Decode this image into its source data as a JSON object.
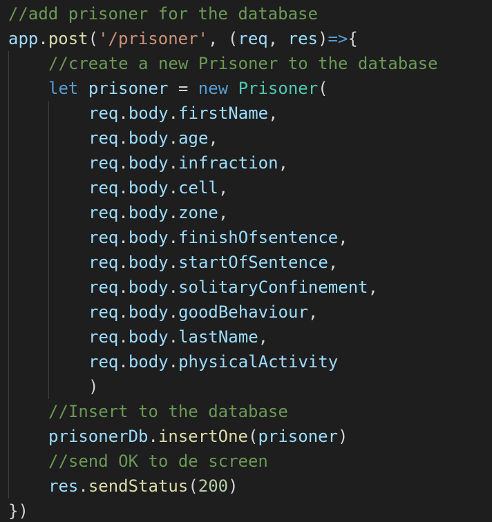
{
  "editor": {
    "theme": {
      "background": "#1e1e1e",
      "comment": "#6a9955",
      "variable": "#9cdcfe",
      "function": "#dcdcaa",
      "string": "#ce9178",
      "keyword": "#569cd6",
      "class": "#4ec9b0",
      "number": "#b5cea8",
      "punctuation": "#d4d4d4"
    },
    "lines": [
      {
        "indent": 0,
        "tokens": [
          {
            "t": "comment",
            "v": "//add prisoner for the database"
          }
        ]
      },
      {
        "indent": 0,
        "tokens": [
          {
            "t": "variable",
            "v": "app"
          },
          {
            "t": "punct",
            "v": "."
          },
          {
            "t": "func",
            "v": "post"
          },
          {
            "t": "punct",
            "v": "("
          },
          {
            "t": "string",
            "v": "'/prisoner'"
          },
          {
            "t": "punct",
            "v": ", ("
          },
          {
            "t": "variable",
            "v": "req"
          },
          {
            "t": "punct",
            "v": ", "
          },
          {
            "t": "variable",
            "v": "res"
          },
          {
            "t": "punct",
            "v": ")"
          },
          {
            "t": "keyword",
            "v": "=>"
          },
          {
            "t": "punct",
            "v": "{"
          }
        ]
      },
      {
        "indent": 1,
        "tokens": [
          {
            "t": "comment",
            "v": "//create a new Prisoner to the database"
          }
        ]
      },
      {
        "indent": 1,
        "tokens": [
          {
            "t": "keyword",
            "v": "let"
          },
          {
            "t": "punct",
            "v": " "
          },
          {
            "t": "variable",
            "v": "prisoner"
          },
          {
            "t": "punct",
            "v": " = "
          },
          {
            "t": "keyword",
            "v": "new"
          },
          {
            "t": "punct",
            "v": " "
          },
          {
            "t": "class",
            "v": "Prisoner"
          },
          {
            "t": "punct",
            "v": "("
          }
        ]
      },
      {
        "indent": 2,
        "tokens": [
          {
            "t": "variable",
            "v": "req"
          },
          {
            "t": "punct",
            "v": "."
          },
          {
            "t": "variable",
            "v": "body"
          },
          {
            "t": "punct",
            "v": "."
          },
          {
            "t": "variable",
            "v": "firstName"
          },
          {
            "t": "punct",
            "v": ","
          }
        ]
      },
      {
        "indent": 2,
        "tokens": [
          {
            "t": "variable",
            "v": "req"
          },
          {
            "t": "punct",
            "v": "."
          },
          {
            "t": "variable",
            "v": "body"
          },
          {
            "t": "punct",
            "v": "."
          },
          {
            "t": "variable",
            "v": "age"
          },
          {
            "t": "punct",
            "v": ","
          }
        ]
      },
      {
        "indent": 2,
        "tokens": [
          {
            "t": "variable",
            "v": "req"
          },
          {
            "t": "punct",
            "v": "."
          },
          {
            "t": "variable",
            "v": "body"
          },
          {
            "t": "punct",
            "v": "."
          },
          {
            "t": "variable",
            "v": "infraction"
          },
          {
            "t": "punct",
            "v": ","
          }
        ]
      },
      {
        "indent": 2,
        "tokens": [
          {
            "t": "variable",
            "v": "req"
          },
          {
            "t": "punct",
            "v": "."
          },
          {
            "t": "variable",
            "v": "body"
          },
          {
            "t": "punct",
            "v": "."
          },
          {
            "t": "variable",
            "v": "cell"
          },
          {
            "t": "punct",
            "v": ","
          }
        ]
      },
      {
        "indent": 2,
        "tokens": [
          {
            "t": "variable",
            "v": "req"
          },
          {
            "t": "punct",
            "v": "."
          },
          {
            "t": "variable",
            "v": "body"
          },
          {
            "t": "punct",
            "v": "."
          },
          {
            "t": "variable",
            "v": "zone"
          },
          {
            "t": "punct",
            "v": ","
          }
        ]
      },
      {
        "indent": 2,
        "tokens": [
          {
            "t": "variable",
            "v": "req"
          },
          {
            "t": "punct",
            "v": "."
          },
          {
            "t": "variable",
            "v": "body"
          },
          {
            "t": "punct",
            "v": "."
          },
          {
            "t": "variable",
            "v": "finishOfsentence"
          },
          {
            "t": "punct",
            "v": ","
          }
        ]
      },
      {
        "indent": 2,
        "tokens": [
          {
            "t": "variable",
            "v": "req"
          },
          {
            "t": "punct",
            "v": "."
          },
          {
            "t": "variable",
            "v": "body"
          },
          {
            "t": "punct",
            "v": "."
          },
          {
            "t": "variable",
            "v": "startOfSentence"
          },
          {
            "t": "punct",
            "v": ","
          }
        ]
      },
      {
        "indent": 2,
        "tokens": [
          {
            "t": "variable",
            "v": "req"
          },
          {
            "t": "punct",
            "v": "."
          },
          {
            "t": "variable",
            "v": "body"
          },
          {
            "t": "punct",
            "v": "."
          },
          {
            "t": "variable",
            "v": "solitaryConfinement"
          },
          {
            "t": "punct",
            "v": ","
          }
        ]
      },
      {
        "indent": 2,
        "tokens": [
          {
            "t": "variable",
            "v": "req"
          },
          {
            "t": "punct",
            "v": "."
          },
          {
            "t": "variable",
            "v": "body"
          },
          {
            "t": "punct",
            "v": "."
          },
          {
            "t": "variable",
            "v": "goodBehaviour"
          },
          {
            "t": "punct",
            "v": ","
          }
        ]
      },
      {
        "indent": 2,
        "tokens": [
          {
            "t": "variable",
            "v": "req"
          },
          {
            "t": "punct",
            "v": "."
          },
          {
            "t": "variable",
            "v": "body"
          },
          {
            "t": "punct",
            "v": "."
          },
          {
            "t": "variable",
            "v": "lastName"
          },
          {
            "t": "punct",
            "v": ","
          }
        ]
      },
      {
        "indent": 2,
        "tokens": [
          {
            "t": "variable",
            "v": "req"
          },
          {
            "t": "punct",
            "v": "."
          },
          {
            "t": "variable",
            "v": "body"
          },
          {
            "t": "punct",
            "v": "."
          },
          {
            "t": "variable",
            "v": "physicalActivity"
          }
        ]
      },
      {
        "indent": 2,
        "tokens": [
          {
            "t": "punct",
            "v": ")"
          }
        ]
      },
      {
        "indent": 1,
        "tokens": [
          {
            "t": "comment",
            "v": "//Insert to the database"
          }
        ]
      },
      {
        "indent": 1,
        "tokens": [
          {
            "t": "variable",
            "v": "prisonerDb"
          },
          {
            "t": "punct",
            "v": "."
          },
          {
            "t": "func",
            "v": "insertOne"
          },
          {
            "t": "punct",
            "v": "("
          },
          {
            "t": "variable",
            "v": "prisoner"
          },
          {
            "t": "punct",
            "v": ")"
          }
        ]
      },
      {
        "indent": 1,
        "tokens": [
          {
            "t": "comment",
            "v": "//send OK to de screen"
          }
        ]
      },
      {
        "indent": 1,
        "tokens": [
          {
            "t": "variable",
            "v": "res"
          },
          {
            "t": "punct",
            "v": "."
          },
          {
            "t": "func",
            "v": "sendStatus"
          },
          {
            "t": "punct",
            "v": "("
          },
          {
            "t": "number",
            "v": "200"
          },
          {
            "t": "punct",
            "v": ")"
          }
        ]
      },
      {
        "indent": 0,
        "tokens": [
          {
            "t": "punct",
            "v": "})"
          }
        ]
      }
    ]
  }
}
